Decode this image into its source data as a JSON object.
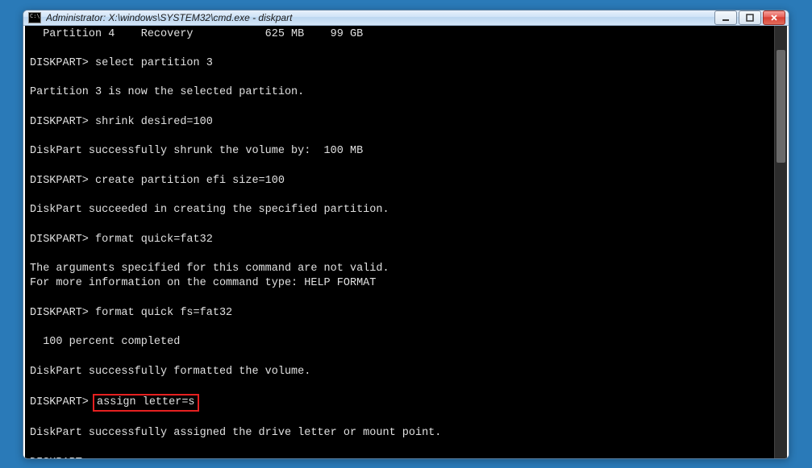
{
  "window": {
    "title": "Administrator: X:\\windows\\SYSTEM32\\cmd.exe - diskpart"
  },
  "console": {
    "lines": [
      "  Partition 4    Recovery           625 MB    99 GB",
      "",
      "DISKPART> select partition 3",
      "",
      "Partition 3 is now the selected partition.",
      "",
      "DISKPART> shrink desired=100",
      "",
      "DiskPart successfully shrunk the volume by:  100 MB",
      "",
      "DISKPART> create partition efi size=100",
      "",
      "DiskPart succeeded in creating the specified partition.",
      "",
      "DISKPART> format quick=fat32",
      "",
      "The arguments specified for this command are not valid.",
      "For more information on the command type: HELP FORMAT",
      "",
      "DISKPART> format quick fs=fat32",
      "",
      "  100 percent completed",
      "",
      "DiskPart successfully formatted the volume.",
      "",
      null,
      "",
      "DiskPart successfully assigned the drive letter or mount point.",
      "",
      "DISKPART>"
    ],
    "highlight_line": {
      "prefix": "DISKPART> ",
      "boxed": "assign letter=s"
    }
  }
}
